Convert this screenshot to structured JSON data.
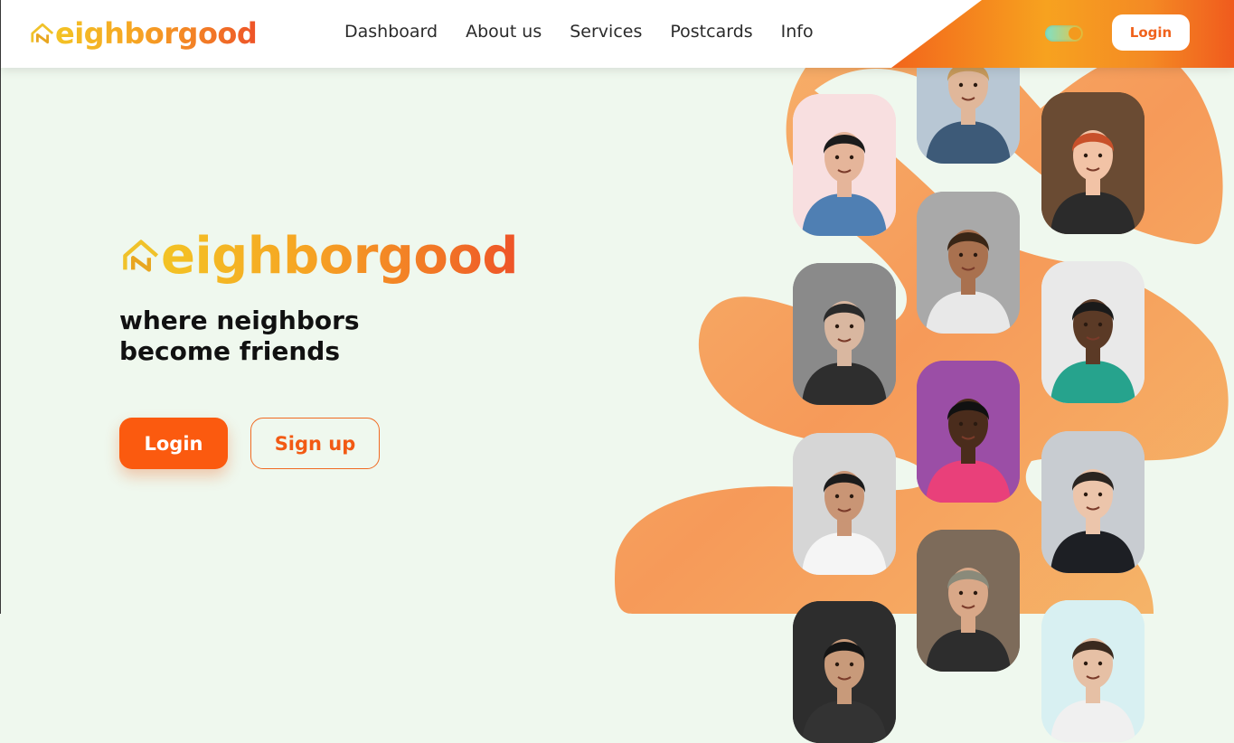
{
  "header": {
    "logo_text": "eighborgood",
    "logo_icon": "house-n-icon",
    "nav": [
      "Dashboard",
      "About us",
      "Services",
      "Postcards",
      "Info"
    ],
    "theme_toggle_icon": "theme-toggle",
    "login_label": "Login"
  },
  "hero": {
    "logo_text": "eighborgood",
    "tagline": [
      "where neighbors",
      "become friends"
    ],
    "login_label": "Login",
    "signup_label": "Sign up"
  },
  "gallery": {
    "photos": [
      {
        "bg": "#f8dfe0",
        "skin": "#e5b59a",
        "hair": "#1b1b1b",
        "shirt": "#4f7fb3"
      },
      {
        "bg": "#b8c7d4",
        "skin": "#e0b79a",
        "hair": "#c79a5b",
        "shirt": "#3d5a78"
      },
      {
        "bg": "#6a4b33",
        "skin": "#f2c3a6",
        "hair": "#c8502a",
        "shirt": "#2b2b2b"
      },
      {
        "bg": "#8a8a8a",
        "skin": "#d9b7a0",
        "hair": "#2a2a2a",
        "shirt": "#2e2e2e"
      },
      {
        "bg": "#a9a9a9",
        "skin": "#a9714f",
        "hair": "#3a2616",
        "shirt": "#e8e8e8"
      },
      {
        "bg": "#e9e9e9",
        "skin": "#5b3a26",
        "hair": "#1a1a1a",
        "shirt": "#26a38d"
      },
      {
        "bg": "#d6d6d6",
        "skin": "#c99575",
        "hair": "#1b1b1b",
        "shirt": "#f5f5f5"
      },
      {
        "bg": "#9b4ea6",
        "skin": "#4a2c1c",
        "hair": "#111111",
        "shirt": "#e9407a"
      },
      {
        "bg": "#c8ccd1",
        "skin": "#ecc5ab",
        "hair": "#2a2420",
        "shirt": "#1d1f24"
      },
      {
        "bg": "#7d6b5a",
        "skin": "#d9a888",
        "hair": "#8a8a7a",
        "shirt": "#2d2d2d"
      },
      {
        "bg": "#2d2d2d",
        "skin": "#c89a7a",
        "hair": "#151515",
        "shirt": "#333333"
      },
      {
        "bg": "#d8f0f2",
        "skin": "#e6c0a5",
        "hair": "#3a2a1f",
        "shirt": "#f0f0f0"
      }
    ]
  },
  "colors": {
    "brand_orange": "#fb5a0f",
    "brand_yellow": "#f3c324",
    "background": "#eff8ee"
  }
}
